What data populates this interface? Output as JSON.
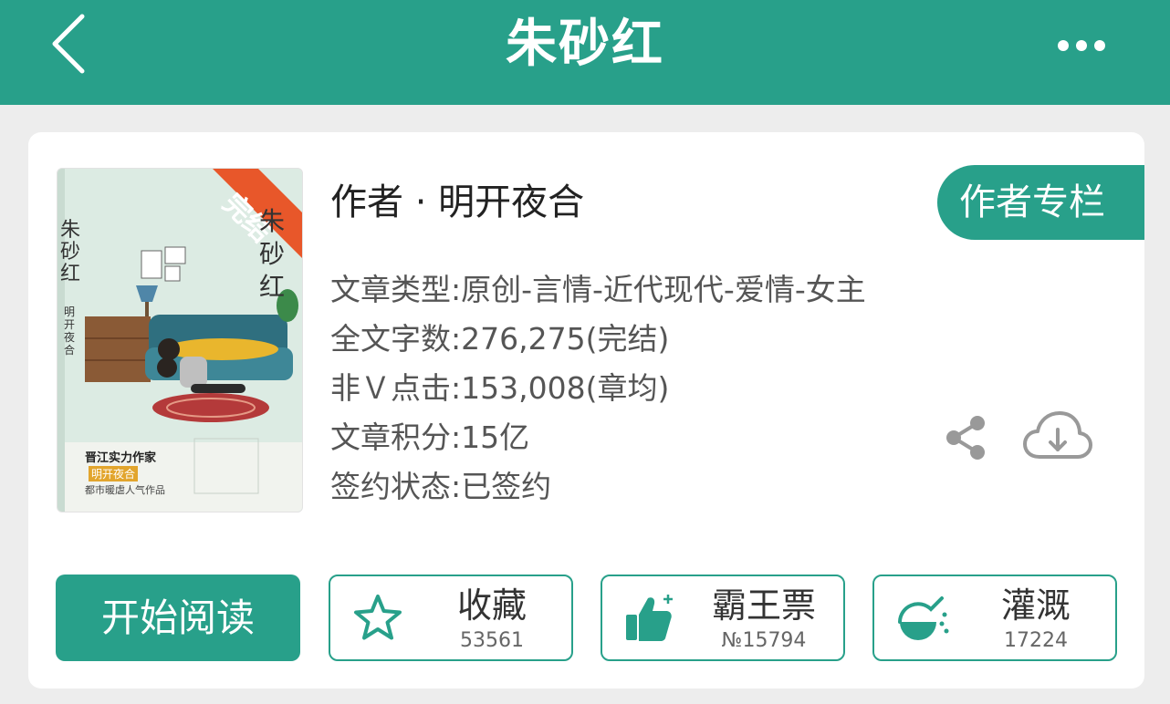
{
  "header": {
    "title": "朱砂红"
  },
  "book": {
    "cover": {
      "ribbon": "完结",
      "title_vertical": "朱砂红",
      "author_vertical": "明开夜合",
      "tagline_1": "晋江实力作家",
      "tagline_2": "明开夜合",
      "tagline_3": "都市暖虐人气作品"
    },
    "author_line": "作者 · 明开夜合",
    "author_column_label": "作者专栏",
    "info": {
      "type": "文章类型:原创-言情-近代现代-爱情-女主",
      "word_count": "全文字数:276,275(完结)",
      "clicks": "非Ｖ点击:153,008(章均)",
      "score": "文章积分:15亿",
      "sign_status": "签约状态:已签约"
    }
  },
  "actions": {
    "read_label": "开始阅读",
    "favorite": {
      "label": "收藏",
      "count": "53561"
    },
    "ticket": {
      "label": "霸王票",
      "count": "№15794"
    },
    "water": {
      "label": "灌溉",
      "count": "17224"
    }
  },
  "colors": {
    "accent": "#28a08a",
    "ribbon": "#e8572a"
  }
}
